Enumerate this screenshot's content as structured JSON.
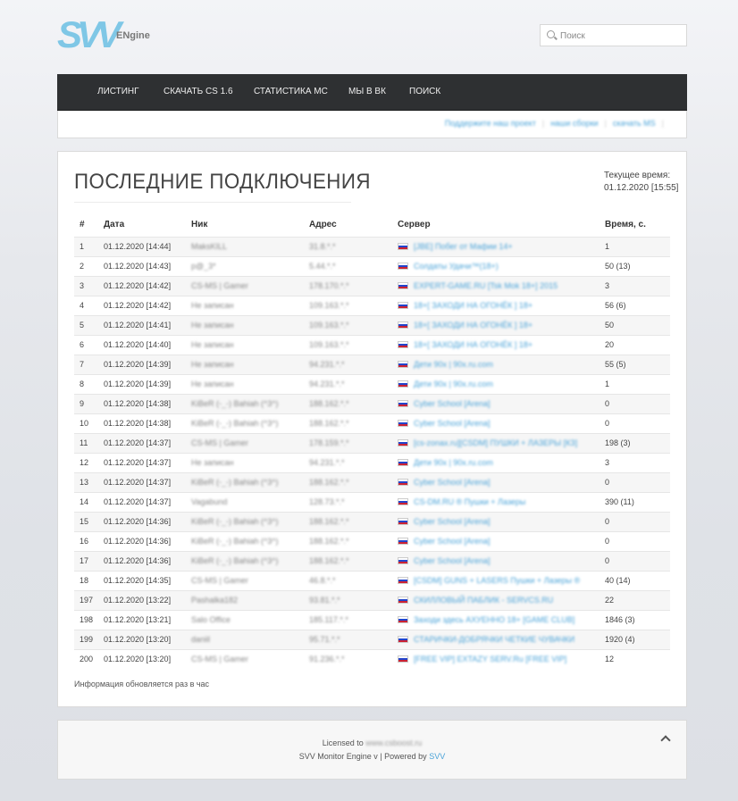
{
  "brand": {
    "logo_text": "SVV",
    "engine_text": "ENgine"
  },
  "search": {
    "placeholder": "Поиск"
  },
  "nav": {
    "items": [
      {
        "label": "Листинг"
      },
      {
        "label": "Скачать CS 1.6"
      },
      {
        "label": "Статистика MC"
      },
      {
        "label": "Мы в ВК"
      },
      {
        "label": "Поиск"
      }
    ]
  },
  "subnav": {
    "links": [
      {
        "label": "Поддержите наш проект"
      },
      {
        "label": "наши сборки"
      },
      {
        "label": "скачать MS"
      }
    ]
  },
  "main": {
    "title": "ПОСЛЕДНИЕ ПОДКЛЮЧЕНИЯ",
    "time_label": "Текущее время:",
    "time_value": "01.12.2020 [15:55]",
    "columns": [
      "#",
      "Дата",
      "Ник",
      "Адрес",
      "Сервер",
      "Время, с."
    ],
    "rows": [
      [
        "1",
        "01.12.2020 [14:44]",
        "MaksKILL",
        "31.8.*.*",
        "[JBE] Побег от Мафии 14+",
        "1"
      ],
      [
        "2",
        "01.12.2020 [14:43]",
        "p@_3*",
        "5.44.*.*",
        "Солдаты Удачи™(18+)",
        "50 (13)"
      ],
      [
        "3",
        "01.12.2020 [14:42]",
        "CS-MS | Gamer",
        "178.170.*.*",
        "EXPERT-GAME.RU [Tsk Mok 18+] 2015",
        "3"
      ],
      [
        "4",
        "01.12.2020 [14:42]",
        "Не записан",
        "109.163.*.*",
        "18+[ ЗАХОДИ НА ОГОНЁК ] 18+",
        "56 (6)"
      ],
      [
        "5",
        "01.12.2020 [14:41]",
        "Не записан",
        "109.163.*.*",
        "18+[ ЗАХОДИ НА ОГОНЁК ] 18+",
        "50"
      ],
      [
        "6",
        "01.12.2020 [14:40]",
        "Не записан",
        "109.163.*.*",
        "18+[ ЗАХОДИ НА ОГОНЁК ] 18+",
        "20"
      ],
      [
        "7",
        "01.12.2020 [14:39]",
        "Не записан",
        "94.231.*.*",
        "Дети 90х | 90х.ru.com",
        "55 (5)"
      ],
      [
        "8",
        "01.12.2020 [14:39]",
        "Не записан",
        "94.231.*.*",
        "Дети 90х | 90х.ru.com",
        "1"
      ],
      [
        "9",
        "01.12.2020 [14:38]",
        "KiBeR (-_-) Bahiah (^3^)",
        "188.162.*.*",
        "Cyber School [Arena]",
        "0"
      ],
      [
        "10",
        "01.12.2020 [14:38]",
        "KiBeR (-_-) Bahiah (^3^)",
        "188.162.*.*",
        "Cyber School [Arena]",
        "0"
      ],
      [
        "11",
        "01.12.2020 [14:37]",
        "CS-MS | Gamer",
        "178.159.*.*",
        "[cs-zonax.ru][CSDM] ПУШКИ + ЛАЗЕРЫ [КЗ]",
        "198 (3)"
      ],
      [
        "12",
        "01.12.2020 [14:37]",
        "Не записан",
        "94.231.*.*",
        "Дети 90х | 90х.ru.com",
        "3"
      ],
      [
        "13",
        "01.12.2020 [14:37]",
        "KiBeR (-_-) Bahiah (^3^)",
        "188.162.*.*",
        "Cyber School [Arena]",
        "0"
      ],
      [
        "14",
        "01.12.2020 [14:37]",
        "Vagabund",
        "128.73.*.*",
        "CS-DM.RU ® Пушки + Лазеры",
        "390 (11)"
      ],
      [
        "15",
        "01.12.2020 [14:36]",
        "KiBeR (-_-) Bahiah (^3^)",
        "188.162.*.*",
        "Cyber School [Arena]",
        "0"
      ],
      [
        "16",
        "01.12.2020 [14:36]",
        "KiBeR (-_-) Bahiah (^3^)",
        "188.162.*.*",
        "Cyber School [Arena]",
        "0"
      ],
      [
        "17",
        "01.12.2020 [14:36]",
        "KiBeR (-_-) Bahiah (^3^)",
        "188.162.*.*",
        "Cyber School [Arena]",
        "0"
      ],
      [
        "18",
        "01.12.2020 [14:35]",
        "CS-MS | Gamer",
        "46.8.*.*",
        "[CSDM] GUNS + LASERS Пушки + Лазеры ®",
        "40 (14)"
      ],
      [
        "197",
        "01.12.2020 [13:22]",
        "Pashalka182",
        "93.81.*.*",
        "СКИЛЛОВЫЙ ПАБЛИК - SERVCS.RU",
        "22"
      ],
      [
        "198",
        "01.12.2020 [13:21]",
        "Salo Office",
        "185.117.*.*",
        "Заходи здесь АХУЕННО 18+ [GAME CLUB]",
        "1846 (3)"
      ],
      [
        "199",
        "01.12.2020 [13:20]",
        "daniil",
        "95.71.*.*",
        "СТАРИЧКИ-ДОБРЯЧКИ ЧЕТКИЕ ЧУВАЧКИ",
        "1920 (4)"
      ],
      [
        "200",
        "01.12.2020 [13:20]",
        "CS-MS | Gamer",
        "91.236.*.*",
        "[FREE VIP] EXTAZY SERV.Ru [FREE VIP]",
        "12"
      ]
    ],
    "note": "Информация обновляется раз в час"
  },
  "footer": {
    "licensed_prefix": "Licensed to",
    "licensed_site": "www.csboost.ru",
    "engine_text": "SVV Monitor Engine v | Powered by",
    "powered_link": "SVV"
  }
}
